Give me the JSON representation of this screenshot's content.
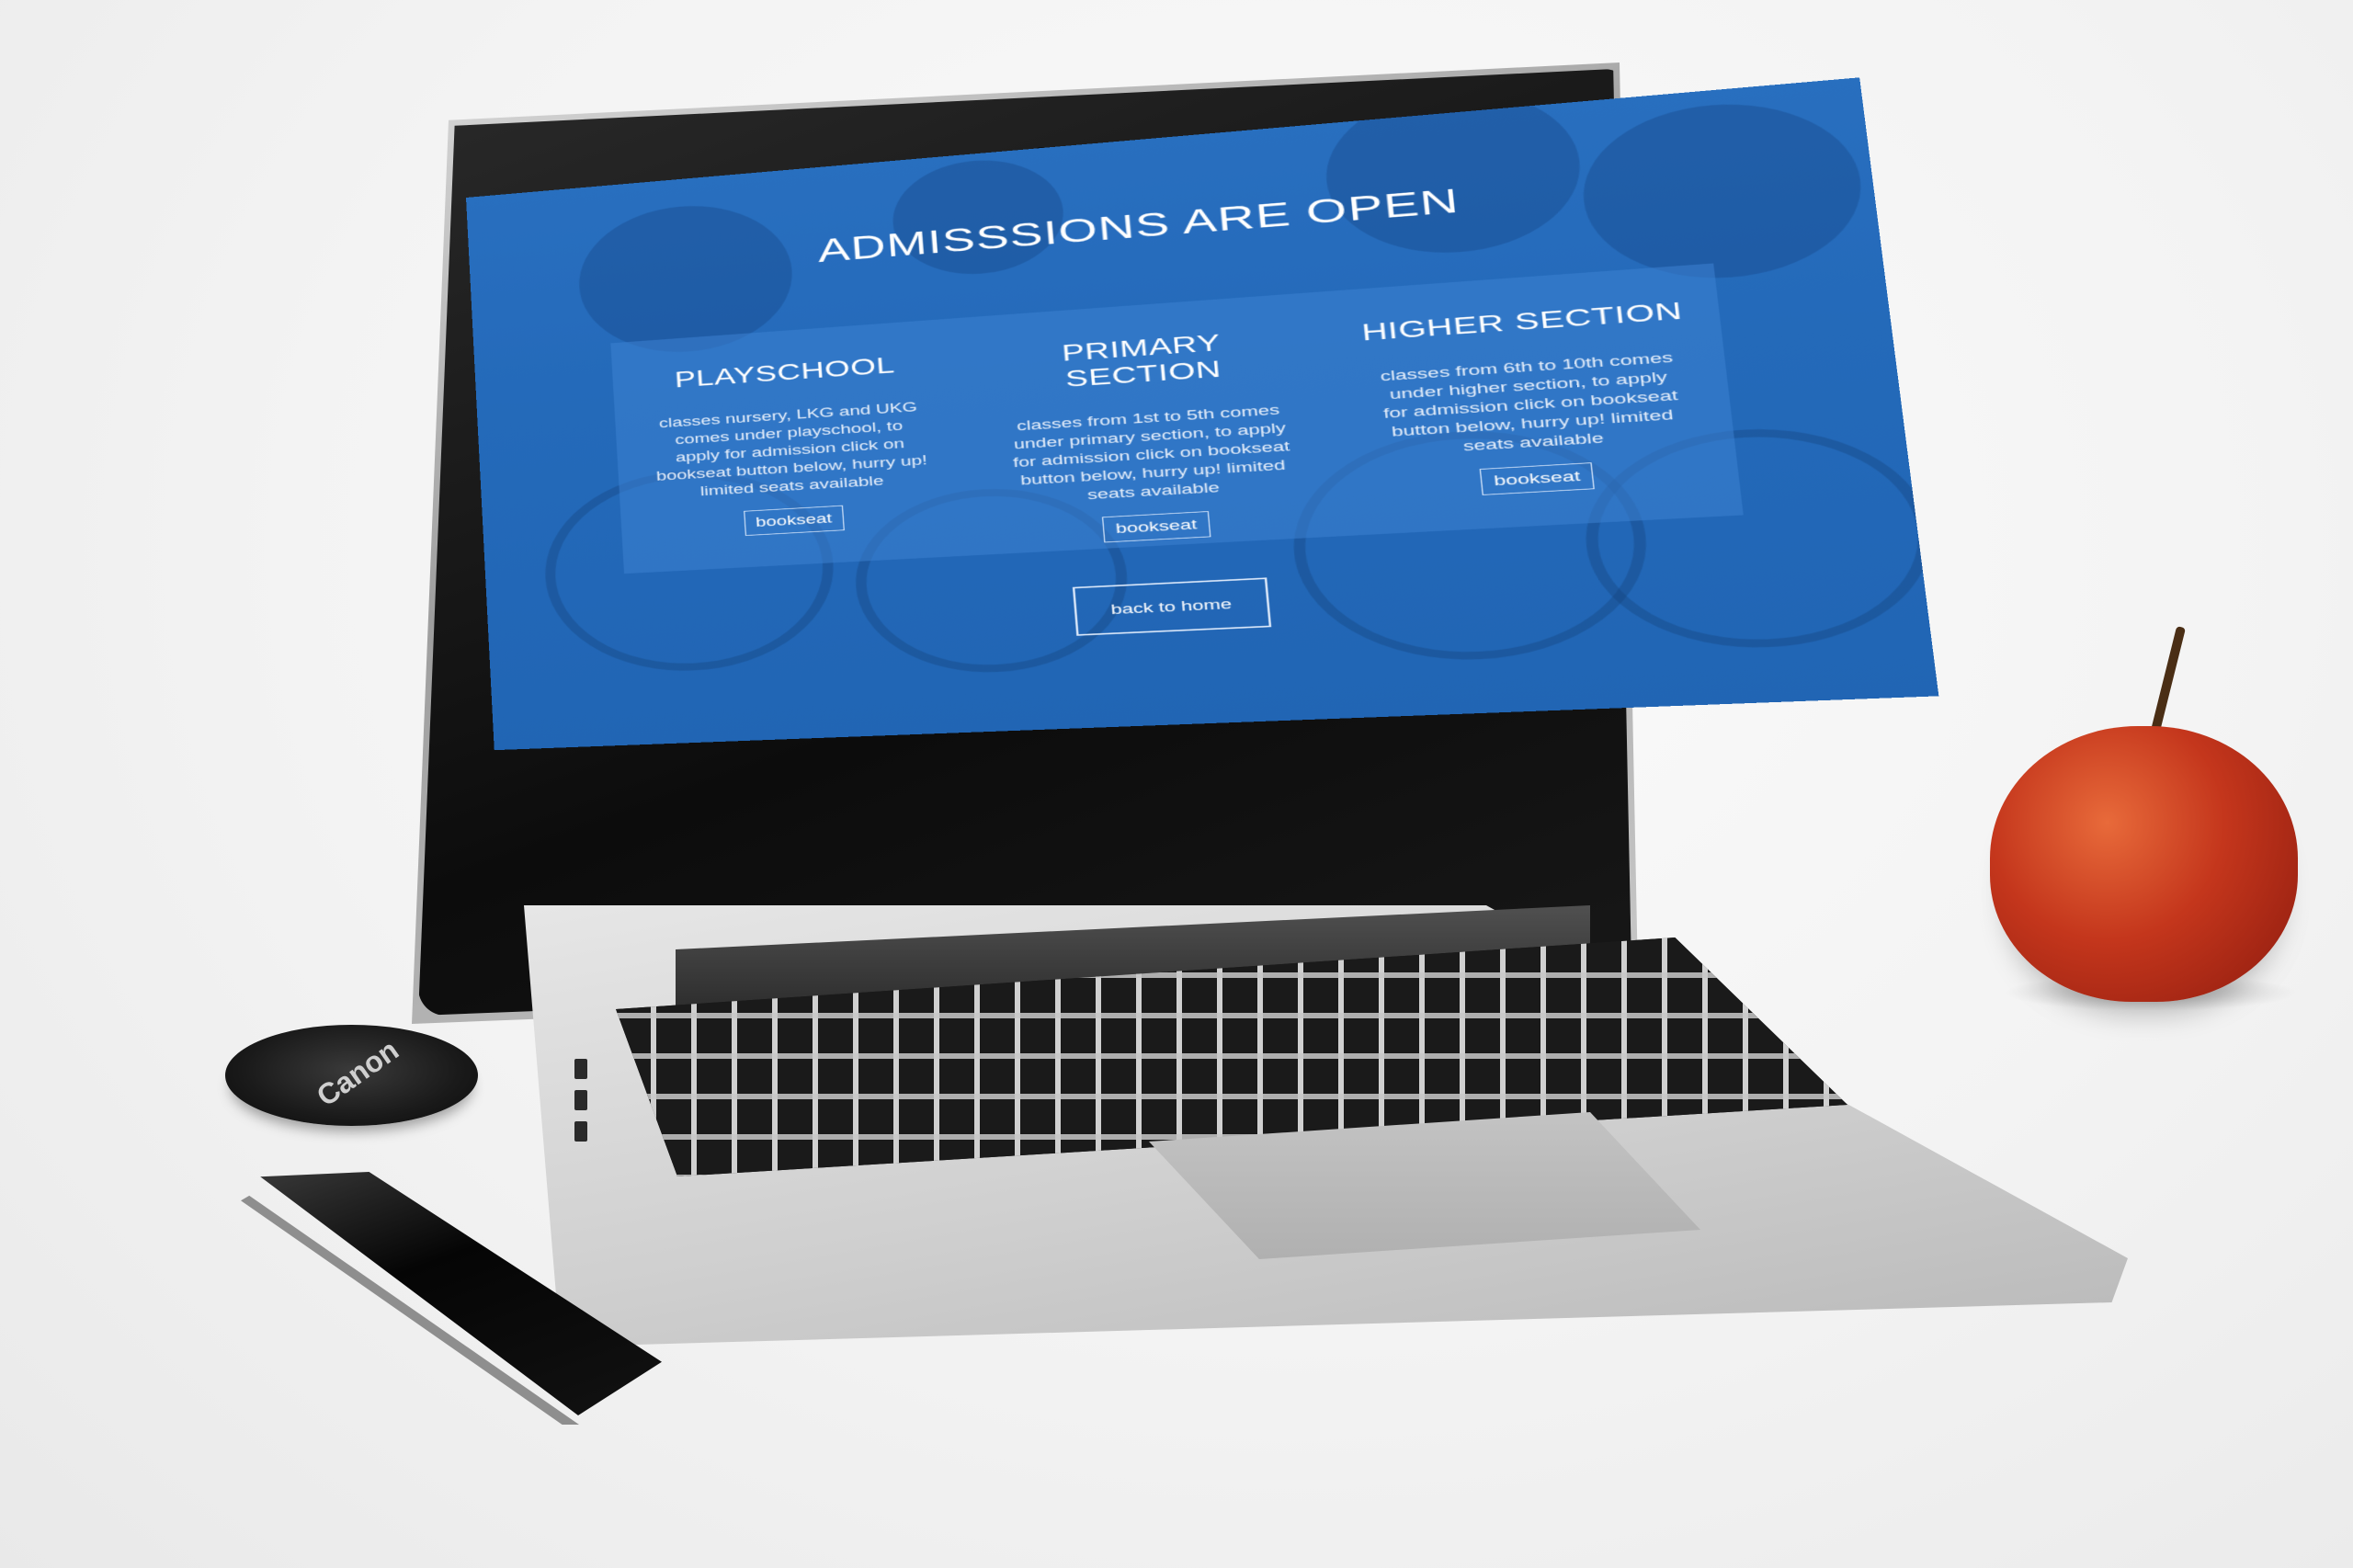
{
  "page": {
    "title": "ADMISSSIONS ARE OPEN",
    "sections": [
      {
        "heading": "PLAYSCHOOL",
        "text": "classes nursery, LKG and UKG comes under playschool, to apply for admission click on bookseat button below, hurry up! limited seats available",
        "button": "bookseat"
      },
      {
        "heading": "PRIMARY SECTION",
        "text": "classes from 1st to 5th comes under primary section, to apply for admission click on bookseat button below, hurry up! limited seats available",
        "button": "bookseat"
      },
      {
        "heading": "HIGHER SECTION",
        "text": "classes from 6th to 10th comes under higher section, to apply for admission click on bookseat button below, hurry up! limited seats available",
        "button": "bookseat"
      }
    ],
    "back_button": "back to home"
  },
  "scene": {
    "lens_cap_logo": "Canon",
    "colors": {
      "screen_blue": "#2566ae",
      "overlay_blue": "#3c82d2",
      "apple_red": "#c4361c",
      "desk": "#f3f3f3"
    },
    "icons": [
      "camera-icon"
    ]
  }
}
